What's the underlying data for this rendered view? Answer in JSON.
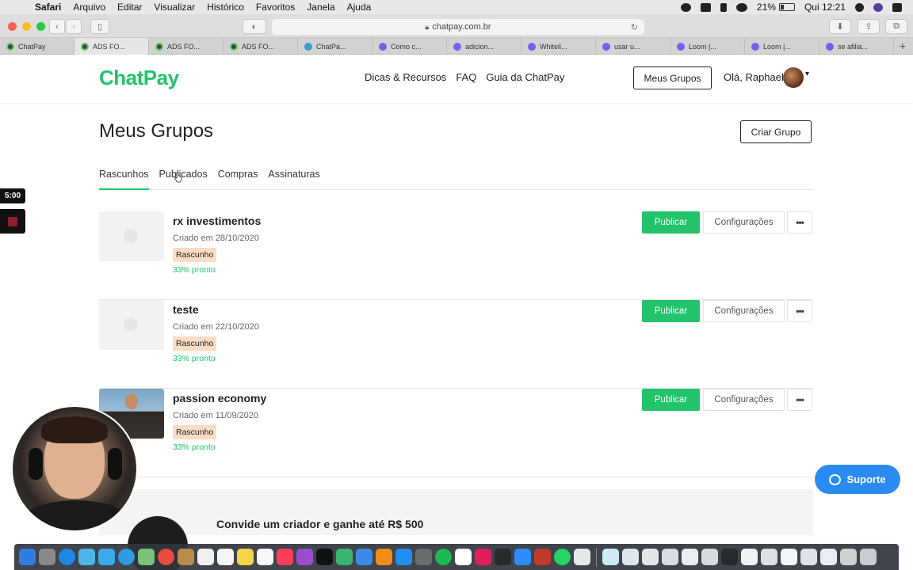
{
  "menubar": {
    "app": "Safari",
    "items": [
      "Arquivo",
      "Editar",
      "Visualizar",
      "Histórico",
      "Favoritos",
      "Janela",
      "Ajuda"
    ],
    "battery": "21%",
    "clock": "Qui 12:21"
  },
  "browser": {
    "url": "chatpay.com.br",
    "tabs": [
      {
        "label": "ChatPay",
        "icon": "chatpay-favicon"
      },
      {
        "label": "ADS FO...",
        "icon": "chatpay-favicon"
      },
      {
        "label": "ADS FO...",
        "icon": "chatpay-favicon"
      },
      {
        "label": "ADS FO...",
        "icon": "chatpay-favicon"
      },
      {
        "label": "ChatPa...",
        "icon": "react-favicon"
      },
      {
        "label": "Como c...",
        "icon": "gear-favicon"
      },
      {
        "label": "adicion...",
        "icon": "gear-favicon"
      },
      {
        "label": "Whiteli...",
        "icon": "gear-favicon"
      },
      {
        "label": "usar u...",
        "icon": "gear-favicon"
      },
      {
        "label": "Loom |...",
        "icon": "loom-favicon"
      },
      {
        "label": "Loom |...",
        "icon": "loom-favicon"
      },
      {
        "label": "se afilia...",
        "icon": "gear-favicon"
      }
    ]
  },
  "header": {
    "logo": "ChatPay",
    "nav": [
      "Dicas & Recursos",
      "FAQ",
      "Guia da ChatPay"
    ],
    "my_groups_button": "Meus Grupos",
    "greeting": "Olá, Raphael"
  },
  "page": {
    "title": "Meus Grupos",
    "create_button": "Criar Grupo",
    "tabs": [
      "Rascunhos",
      "Publicados",
      "Compras",
      "Assinaturas"
    ],
    "active_tab": "Rascunhos"
  },
  "groups": [
    {
      "name": "rx investimentos",
      "created": "Criado em 28/10/2020",
      "status": "Rascunho",
      "progress": "33% pronto",
      "thumb": "placeholder"
    },
    {
      "name": "teste",
      "created": "Criado em 22/10/2020",
      "status": "Rascunho",
      "progress": "33% pronto",
      "thumb": "placeholder"
    },
    {
      "name": "passion economy",
      "created": "Criado em 11/09/2020",
      "status": "Rascunho",
      "progress": "33% pronto",
      "thumb": "photo"
    }
  ],
  "actions": {
    "publish": "Publicar",
    "settings": "Configurações",
    "more": "•••"
  },
  "invite": {
    "text": "Convide um criador e ganhe até R$ 500"
  },
  "support": {
    "label": "Suporte"
  },
  "recording": {
    "timer": "5:00"
  },
  "colors": {
    "brand_green": "#22c36b",
    "support_blue": "#2a8bf2",
    "badge_bg": "#fbdcc4"
  }
}
